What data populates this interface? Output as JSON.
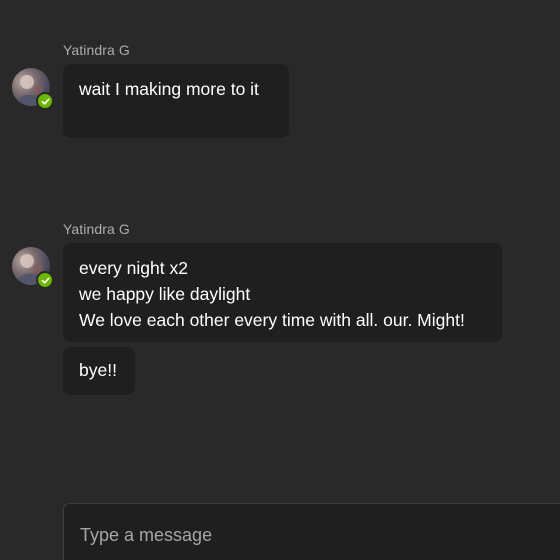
{
  "colors": {
    "background": "#292929",
    "bubble": "#1f1f1f",
    "presence_available": "#6bb700",
    "sender_text": "#adadad"
  },
  "messages": [
    {
      "sender": "Yatindra G",
      "presence": "available",
      "bubbles": [
        {
          "lines": [
            "wait I making more to it"
          ]
        }
      ]
    },
    {
      "sender": "Yatindra G",
      "presence": "available",
      "bubbles": [
        {
          "lines": [
            "every night x2",
            "we happy like daylight",
            "We love each other every time with all. our. Might!"
          ]
        },
        {
          "lines": [
            "bye!!"
          ]
        }
      ]
    }
  ],
  "composer": {
    "placeholder": "Type a message"
  },
  "icons": {
    "presence": "checkmark-icon",
    "avatar": "user-avatar"
  }
}
